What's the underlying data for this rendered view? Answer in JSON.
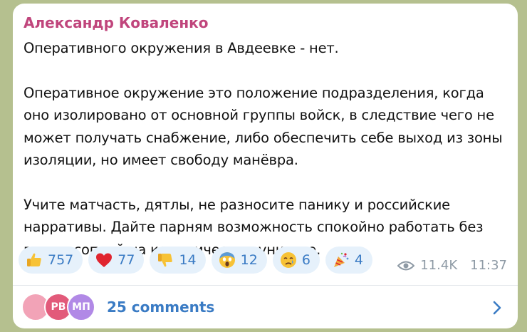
{
  "post": {
    "author": "Александр Коваленко",
    "paragraphs": [
      "Оперативного окружения в Авдеевке - нет.",
      "Оперативное окружение это положение подразделения, когда оно изолировано от основной группы войск, в следствие чего не может получать снабжение, либо обеспечить себе выход из зоны изоляции, но имеет свободу манёвра.",
      "Учите матчасть, дятлы, не разносите панику и российские нарративы. Дайте парням возможность спокойно работать без ваших соплей на керамическом унитазе."
    ]
  },
  "reactions": [
    {
      "icon": "thumbs-up-icon",
      "count": "757"
    },
    {
      "icon": "red-heart-icon",
      "count": "77"
    },
    {
      "icon": "thumbs-down-icon",
      "count": "14"
    },
    {
      "icon": "screaming-face-icon",
      "count": "12"
    },
    {
      "icon": "crying-face-icon",
      "count": "6"
    },
    {
      "icon": "party-popper-icon",
      "count": "4"
    }
  ],
  "meta": {
    "views": "11.4K",
    "time": "11:37"
  },
  "comments": {
    "label": "25 comments",
    "avatars": [
      "",
      "PB",
      "МП"
    ]
  },
  "colors": {
    "author": "#c0457c",
    "accent": "#3a7bc4",
    "background": "#b5c08f",
    "reaction_bg": "#e6f1fb"
  }
}
